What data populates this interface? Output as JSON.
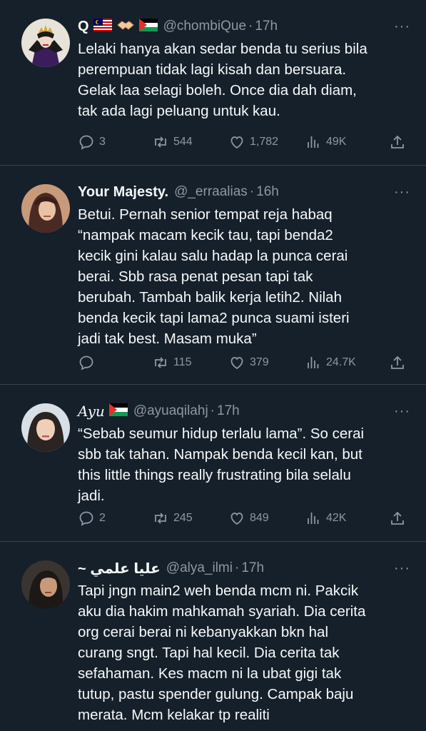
{
  "tweets": [
    {
      "name": "Q",
      "flags": [
        "malaysia",
        "handshake",
        "palestine"
      ],
      "handle": "@chombiQue",
      "time": "17h",
      "lines": [
        "Lelaki hanya akan sedar benda tu serius bila",
        "perempuan tidak lagi kisah dan bersuara.",
        "Gelak laa selagi boleh. Once dia dah diam,",
        "tak ada lagi peluang untuk kau."
      ],
      "replies": "3",
      "retweets": "544",
      "likes": "1,782",
      "views": "49K"
    },
    {
      "name": "Your Majesty.",
      "flags": [],
      "handle": "@_erraalias",
      "time": "16h",
      "lines": [
        "Betui. Pernah senior tempat reja habaq",
        "“nampak macam kecik tau, tapi benda2",
        "kecik gini kalau salu hadap la punca cerai",
        "berai. Sbb rasa penat pesan tapi tak",
        "berubah. Tambah balik kerja letih2. Nilah",
        "benda kecik tapi lama2 punca suami isteri",
        "jadi tak best. Masam muka”"
      ],
      "replies": "",
      "retweets": "115",
      "likes": "379",
      "views": "24.7K"
    },
    {
      "name": "Ayu",
      "flags": [
        "palestine"
      ],
      "handle": "@ayuaqilahj",
      "time": "17h",
      "lines": [
        "“Sebab seumur hidup terlalu lama”. So cerai",
        "sbb tak tahan. Nampak benda kecil kan, but",
        "this little things really frustrating bila selalu",
        "jadi."
      ],
      "replies": "2",
      "retweets": "245",
      "likes": "849",
      "views": "42K"
    },
    {
      "name": "~ عليا علمي",
      "flags": [],
      "handle": "@alya_ilmi",
      "time": "17h",
      "lines": [
        "Tapi jngn main2 weh benda mcm ni. Pakcik",
        "aku dia hakim mahkamah syariah. Dia cerita",
        "org cerai berai ni kebanyakkan bkn hal",
        "curang sngt. Tapi hal kecil. Dia cerita tak",
        "sefahaman. Kes macm ni la ubat gigi tak",
        "tutup, pastu spender gulung. Campak baju",
        "merata. Mcm kelakar tp realiti"
      ],
      "replies": "",
      "retweets": "",
      "likes": "",
      "views": ""
    }
  ],
  "icons": {
    "reply": "reply-icon",
    "retweet": "retweet-icon",
    "like": "heart-icon",
    "views": "views-icon",
    "share": "share-icon",
    "more": "more-icon"
  },
  "more_glyph": "···",
  "colors": {
    "background": "#15202b",
    "divider": "#38444d",
    "text": "#f7f9f9",
    "secondary": "#8b98a5"
  }
}
